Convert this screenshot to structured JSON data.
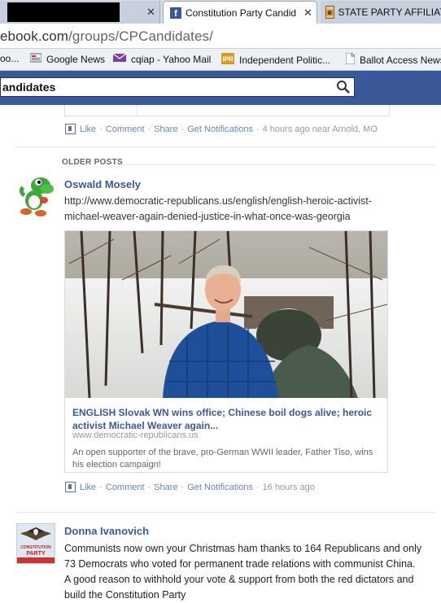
{
  "browser": {
    "tabs": [
      {
        "label": ""
      },
      {
        "label": "Constitution Party Candid"
      },
      {
        "label": "STATE PARTY AFFILIAT"
      }
    ],
    "url": {
      "host": "ebook.com",
      "path": "/groups/CPCandidates/"
    },
    "bookmarks": [
      {
        "label": "oo...",
        "icon": "page-icon"
      },
      {
        "label": "Google News",
        "icon": "news-icon"
      },
      {
        "label": "cqiap - Yahoo Mail",
        "icon": "mail-icon"
      },
      {
        "label": "Independent Politic...",
        "icon": "ipr-icon"
      },
      {
        "label": "Ballot Access News",
        "icon": "page-icon"
      }
    ]
  },
  "facebook": {
    "search_value": "andidates"
  },
  "feed": {
    "top_actions": {
      "like": "Like",
      "comment": "Comment",
      "share": "Share",
      "notifications": "Get Notifications",
      "time": "4 hours ago near Arnold, MO"
    },
    "older_posts_label": "OLDER POSTS",
    "posts": [
      {
        "author": "Oswald Mosely",
        "link_text": "http://www.democratic-republicans.us/english/english-heroic-activist-michael-weaver-again-denied-justice-in-what-once-was-georgia",
        "attachment": {
          "title": "ENGLISH Slovak WN wins office; Chinese boil dogs alive; heroic activist Michael Weaver again...",
          "domain": "www.democratic-republicans.us",
          "description": "An open supporter of the brave, pro-German WWII leader, Father Tiso, wins his election campaign!"
        },
        "actions": {
          "like": "Like",
          "comment": "Comment",
          "share": "Share",
          "notifications": "Get Notifications",
          "time": "16 hours ago"
        }
      },
      {
        "author": "Donna Ivanovich",
        "text": "Communists now own your Christmas ham thanks to 164 Republicans and only 73 Democrats who voted for permanent trade relations with communist China. A good reason to withhold your vote & support from both the red dictators and build the Constitution Party"
      }
    ],
    "avatar2_text": "CONSTITUTION PARTY"
  },
  "colors": {
    "facebook_blue": "#3b5998",
    "link": "#3b5998",
    "meta_link": "#6d84b4"
  }
}
